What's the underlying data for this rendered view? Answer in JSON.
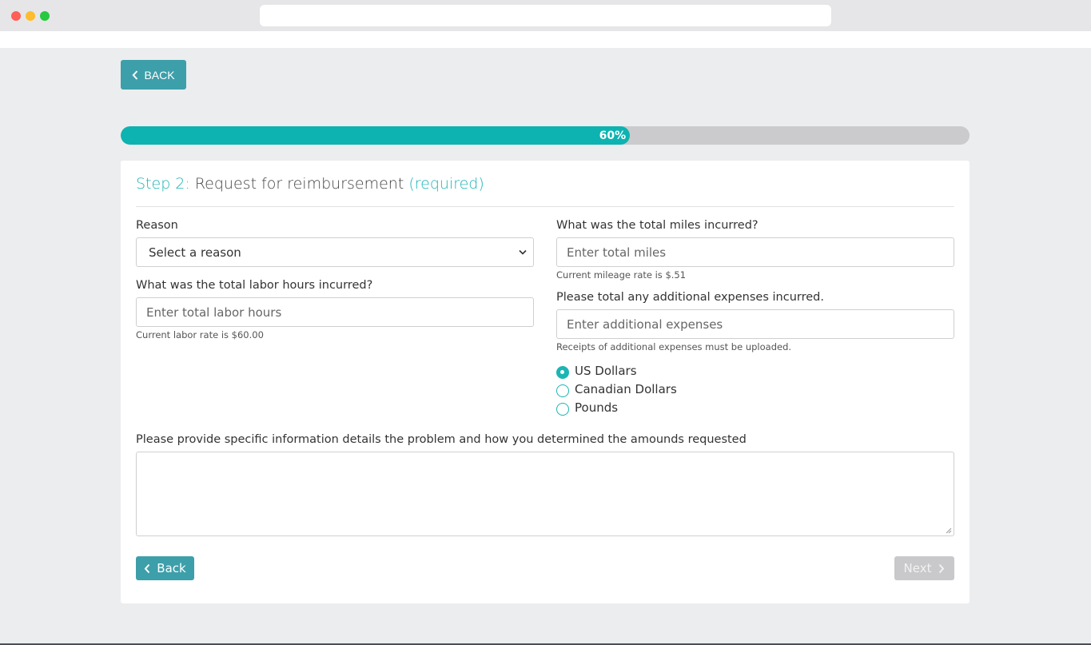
{
  "header": {
    "back_label": "BACK"
  },
  "progress": {
    "percent": 60,
    "label": "60%"
  },
  "form": {
    "step_prefix": "Step 2:",
    "step_title": " Request for reimbursement ",
    "step_suffix": "(required)",
    "reason": {
      "label": "Reason",
      "selected": "Select a reason"
    },
    "miles": {
      "label": "What was the total miles incurred?",
      "placeholder": "Enter total miles",
      "help": "Current mileage rate is $.51"
    },
    "labor": {
      "label": "What was the total labor hours incurred?",
      "placeholder": "Enter total labor hours",
      "help": "Current labor rate is $60.00"
    },
    "expenses": {
      "label": "Please total any additional expenses incurred.",
      "placeholder": "Enter additional expenses",
      "help": "Receipts of additional expenses must be uploaded."
    },
    "currency": {
      "options": [
        "US Dollars",
        "Canadian Dollars",
        "Pounds"
      ],
      "selected_index": 0
    },
    "details": {
      "label": "Please provide specific information details the problem and how you determined the amounds requested"
    },
    "back_label": "Back",
    "next_label": "Next"
  },
  "colors": {
    "accent": "#1bb5b4",
    "button": "#3d9faa",
    "progress_fill": "#0cb3b1",
    "disabled": "#c9c9cb"
  },
  "icons": [
    "chevron-left-icon",
    "chevron-down-icon",
    "chevron-right-icon"
  ]
}
